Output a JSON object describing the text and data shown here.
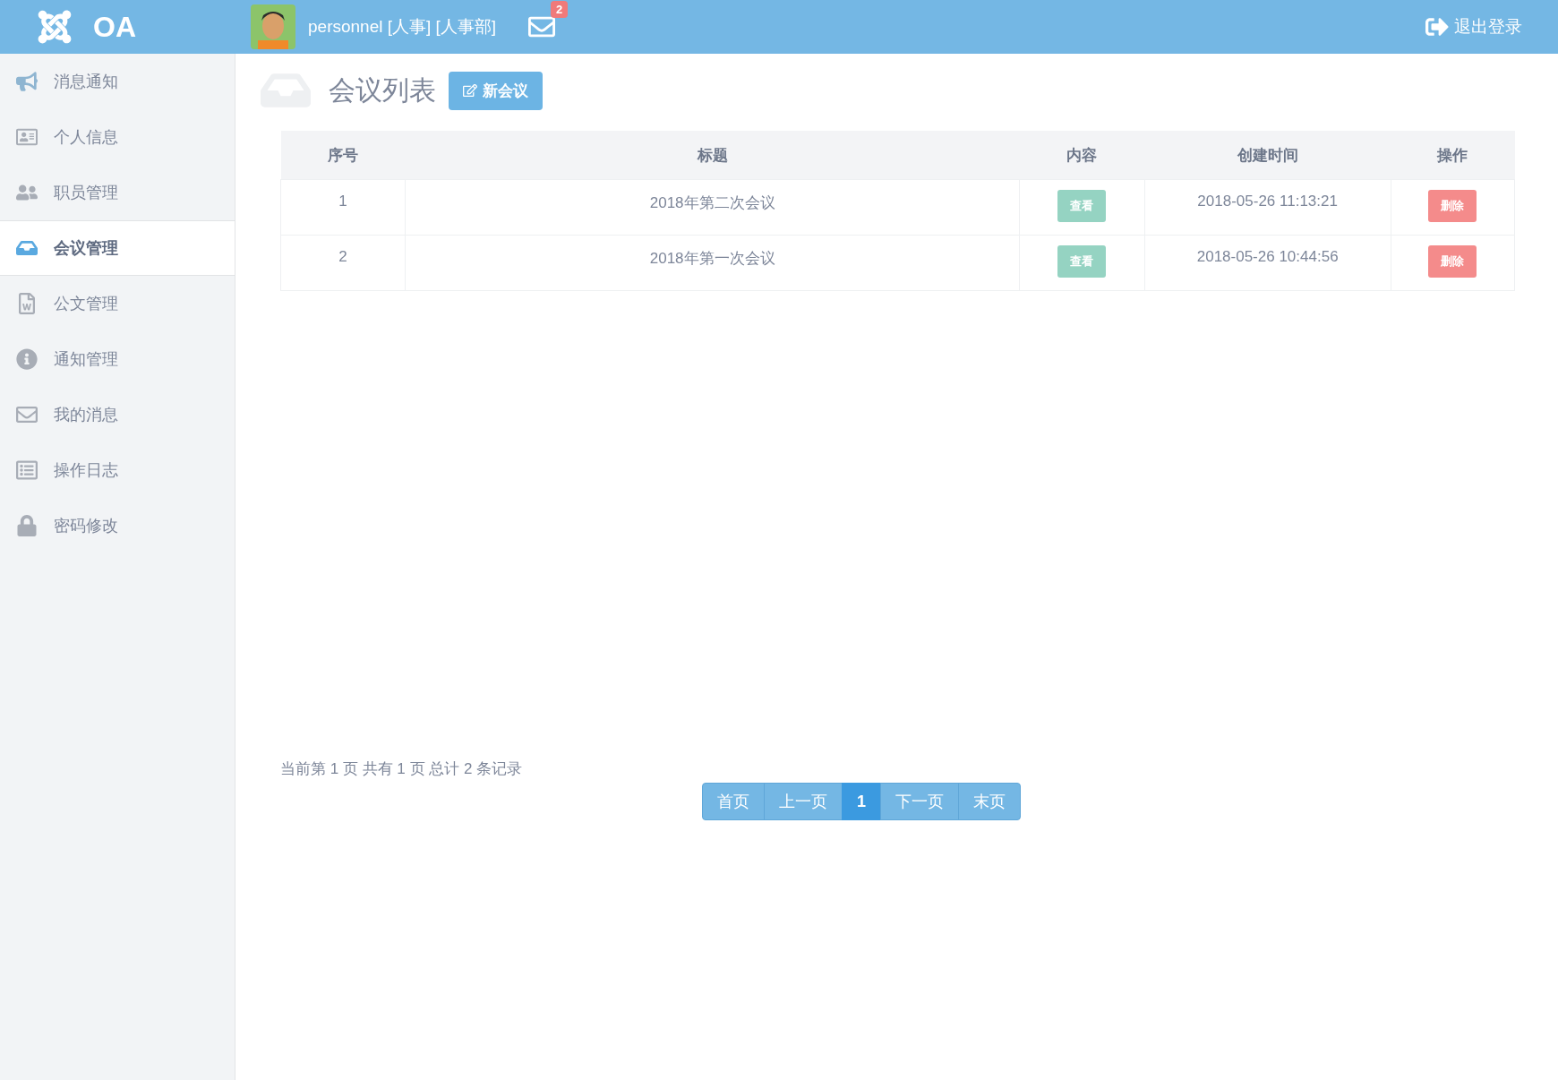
{
  "header": {
    "logo": "OA",
    "user": "personnel [人事] [人事部]",
    "mail_count": "2",
    "logout": "退出登录"
  },
  "sidebar": {
    "items": [
      {
        "kind": "bullhorn",
        "label": "消息通知",
        "selected": false
      },
      {
        "kind": "card",
        "label": "个人信息",
        "selected": false
      },
      {
        "kind": "users",
        "label": "职员管理",
        "selected": false
      },
      {
        "kind": "inbox",
        "label": "会议管理",
        "selected": true
      },
      {
        "kind": "word",
        "label": "公文管理",
        "selected": false
      },
      {
        "kind": "info",
        "label": "通知管理",
        "selected": false
      },
      {
        "kind": "mail",
        "label": "我的消息",
        "selected": false
      },
      {
        "kind": "list",
        "label": "操作日志",
        "selected": false
      },
      {
        "kind": "lock",
        "label": "密码修改",
        "selected": false
      }
    ]
  },
  "page": {
    "title": "会议列表",
    "new_button": "新会议"
  },
  "table": {
    "columns": [
      "序号",
      "标题",
      "内容",
      "创建时间",
      "操作"
    ],
    "rows": [
      {
        "index": "1",
        "title": "2018年第二次会议",
        "view": "查看",
        "created": "2018-05-26 11:13:21",
        "delete": "删除"
      },
      {
        "index": "2",
        "title": "2018年第一次会议",
        "view": "查看",
        "created": "2018-05-26 10:44:56",
        "delete": "删除"
      }
    ]
  },
  "pagination": {
    "summary": "当前第 1 页 共有 1 页 总计 2 条记录",
    "buttons": [
      {
        "label": "首页",
        "selected": false
      },
      {
        "label": "上一页",
        "selected": false
      },
      {
        "label": "1",
        "selected": true
      },
      {
        "label": "下一页",
        "selected": false
      },
      {
        "label": "末页",
        "selected": false
      }
    ]
  }
}
